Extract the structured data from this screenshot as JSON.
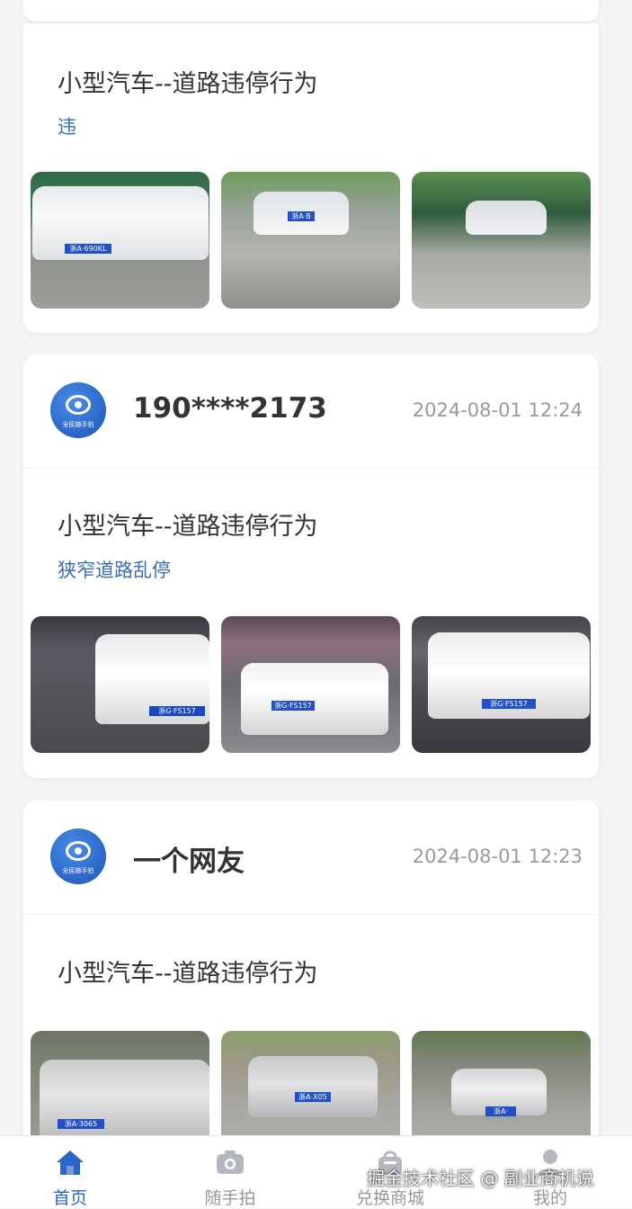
{
  "posts": [
    {
      "title": "小型汽车--道路违停行为",
      "tag": "违",
      "photos": [
        "car-photo-1",
        "car-photo-2",
        "car-photo-3"
      ]
    },
    {
      "user": "190****2173",
      "time": "2024-08-01 12:24",
      "avatar_text": "全民随手拍",
      "title": "小型汽车--道路违停行为",
      "tag": "狭窄道路乱停",
      "photos": [
        "car-photo-1",
        "car-photo-2",
        "car-photo-3"
      ]
    },
    {
      "user": "一个网友",
      "time": "2024-08-01 12:23",
      "avatar_text": "全民随手拍",
      "title": "小型汽车--道路违停行为",
      "photos": [
        "car-photo-1",
        "car-photo-2",
        "car-photo-3"
      ]
    }
  ],
  "tabbar": {
    "items": [
      {
        "label": "首页",
        "icon": "home-icon",
        "active": true
      },
      {
        "label": "随手拍",
        "icon": "camera-icon",
        "active": false
      },
      {
        "label": "兑换商城",
        "icon": "shopping-bag-icon",
        "active": false
      },
      {
        "label": "我的",
        "icon": "user-icon",
        "active": false
      }
    ]
  },
  "watermark": "掘金技术社区 @ 副业商机说",
  "colors": {
    "accent": "#2d66c9",
    "tag": "#3a6cb4",
    "background": "#f4f5f7"
  }
}
